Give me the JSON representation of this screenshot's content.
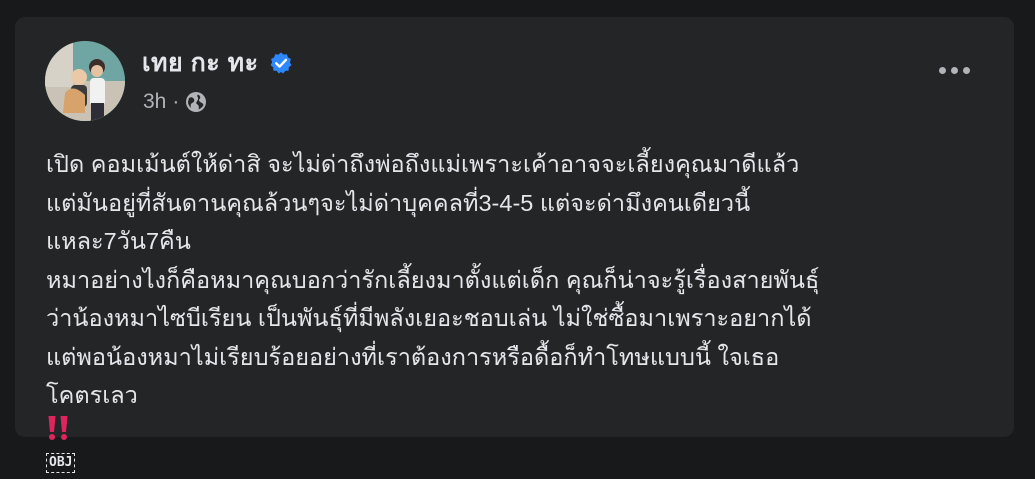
{
  "post": {
    "author_name": "เทย กะ ทะ",
    "timestamp": "3h",
    "separator": "·",
    "privacy_icon": "globe-icon",
    "more_icon": "more-options-icon",
    "lines": [
      "เปิด คอมเม้นต์ให้ด่าสิ จะไม่ด่าถึงพ่อถึงแม่เพราะเค้าอาจจะเลี้ยงคุณมาดีแล้ว",
      "แต่มันอยู่ที่สันดานคุณล้วนๆจะไม่ด่าบุคคลที่3-4-5 แต่จะด่ามึงคนเดียวนี้",
      "แหละ7วัน7คืน",
      "หมาอย่างไงก็คือหมาคุณบอกว่ารักเลี้ยงมาตั้งแต่เด็ก คุณก็น่าจะรู้เรื่องสายพันธุ์",
      "ว่าน้องหมาไซบีเรียน เป็นพันธุ์ที่มีพลังเยอะชอบเล่น ไม่ใช่ซื้อมาเพราะอยากได้",
      "แต่พอน้องหมาไม่เรียบร้อยอย่างที่เราต้องการหรือดื้อก็ทำโทษแบบนี้ ใจเธอ",
      "โคตรเลว"
    ],
    "obj_text": "OBJ",
    "colors": {
      "card_bg": "#242526",
      "page_bg": "#18191a",
      "text": "#e4e6eb",
      "secondary": "#b0b3b8",
      "verified": "#2d88ff",
      "exclamation": "#e0245e"
    }
  }
}
